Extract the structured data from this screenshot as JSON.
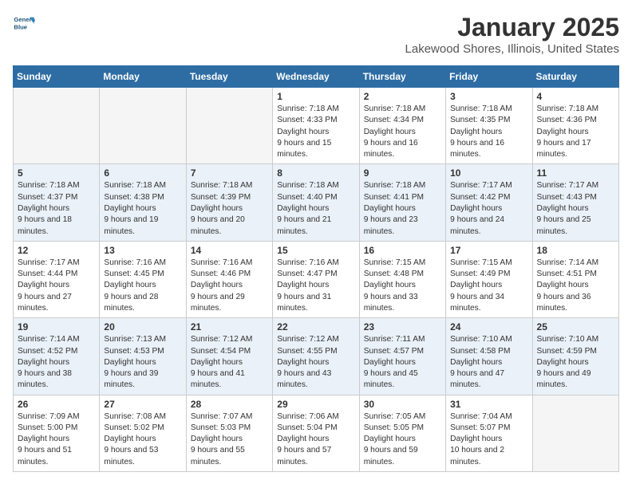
{
  "header": {
    "logo_line1": "General",
    "logo_line2": "Blue",
    "month": "January 2025",
    "location": "Lakewood Shores, Illinois, United States"
  },
  "days_of_week": [
    "Sunday",
    "Monday",
    "Tuesday",
    "Wednesday",
    "Thursday",
    "Friday",
    "Saturday"
  ],
  "weeks": [
    {
      "alt": false,
      "days": [
        {
          "num": "",
          "empty": true
        },
        {
          "num": "",
          "empty": true
        },
        {
          "num": "",
          "empty": true
        },
        {
          "num": "1",
          "sunrise": "7:18 AM",
          "sunset": "4:33 PM",
          "daylight": "9 hours and 15 minutes."
        },
        {
          "num": "2",
          "sunrise": "7:18 AM",
          "sunset": "4:34 PM",
          "daylight": "9 hours and 16 minutes."
        },
        {
          "num": "3",
          "sunrise": "7:18 AM",
          "sunset": "4:35 PM",
          "daylight": "9 hours and 16 minutes."
        },
        {
          "num": "4",
          "sunrise": "7:18 AM",
          "sunset": "4:36 PM",
          "daylight": "9 hours and 17 minutes."
        }
      ]
    },
    {
      "alt": true,
      "days": [
        {
          "num": "5",
          "sunrise": "7:18 AM",
          "sunset": "4:37 PM",
          "daylight": "9 hours and 18 minutes."
        },
        {
          "num": "6",
          "sunrise": "7:18 AM",
          "sunset": "4:38 PM",
          "daylight": "9 hours and 19 minutes."
        },
        {
          "num": "7",
          "sunrise": "7:18 AM",
          "sunset": "4:39 PM",
          "daylight": "9 hours and 20 minutes."
        },
        {
          "num": "8",
          "sunrise": "7:18 AM",
          "sunset": "4:40 PM",
          "daylight": "9 hours and 21 minutes."
        },
        {
          "num": "9",
          "sunrise": "7:18 AM",
          "sunset": "4:41 PM",
          "daylight": "9 hours and 23 minutes."
        },
        {
          "num": "10",
          "sunrise": "7:17 AM",
          "sunset": "4:42 PM",
          "daylight": "9 hours and 24 minutes."
        },
        {
          "num": "11",
          "sunrise": "7:17 AM",
          "sunset": "4:43 PM",
          "daylight": "9 hours and 25 minutes."
        }
      ]
    },
    {
      "alt": false,
      "days": [
        {
          "num": "12",
          "sunrise": "7:17 AM",
          "sunset": "4:44 PM",
          "daylight": "9 hours and 27 minutes."
        },
        {
          "num": "13",
          "sunrise": "7:16 AM",
          "sunset": "4:45 PM",
          "daylight": "9 hours and 28 minutes."
        },
        {
          "num": "14",
          "sunrise": "7:16 AM",
          "sunset": "4:46 PM",
          "daylight": "9 hours and 29 minutes."
        },
        {
          "num": "15",
          "sunrise": "7:16 AM",
          "sunset": "4:47 PM",
          "daylight": "9 hours and 31 minutes."
        },
        {
          "num": "16",
          "sunrise": "7:15 AM",
          "sunset": "4:48 PM",
          "daylight": "9 hours and 33 minutes."
        },
        {
          "num": "17",
          "sunrise": "7:15 AM",
          "sunset": "4:49 PM",
          "daylight": "9 hours and 34 minutes."
        },
        {
          "num": "18",
          "sunrise": "7:14 AM",
          "sunset": "4:51 PM",
          "daylight": "9 hours and 36 minutes."
        }
      ]
    },
    {
      "alt": true,
      "days": [
        {
          "num": "19",
          "sunrise": "7:14 AM",
          "sunset": "4:52 PM",
          "daylight": "9 hours and 38 minutes."
        },
        {
          "num": "20",
          "sunrise": "7:13 AM",
          "sunset": "4:53 PM",
          "daylight": "9 hours and 39 minutes."
        },
        {
          "num": "21",
          "sunrise": "7:12 AM",
          "sunset": "4:54 PM",
          "daylight": "9 hours and 41 minutes."
        },
        {
          "num": "22",
          "sunrise": "7:12 AM",
          "sunset": "4:55 PM",
          "daylight": "9 hours and 43 minutes."
        },
        {
          "num": "23",
          "sunrise": "7:11 AM",
          "sunset": "4:57 PM",
          "daylight": "9 hours and 45 minutes."
        },
        {
          "num": "24",
          "sunrise": "7:10 AM",
          "sunset": "4:58 PM",
          "daylight": "9 hours and 47 minutes."
        },
        {
          "num": "25",
          "sunrise": "7:10 AM",
          "sunset": "4:59 PM",
          "daylight": "9 hours and 49 minutes."
        }
      ]
    },
    {
      "alt": false,
      "days": [
        {
          "num": "26",
          "sunrise": "7:09 AM",
          "sunset": "5:00 PM",
          "daylight": "9 hours and 51 minutes."
        },
        {
          "num": "27",
          "sunrise": "7:08 AM",
          "sunset": "5:02 PM",
          "daylight": "9 hours and 53 minutes."
        },
        {
          "num": "28",
          "sunrise": "7:07 AM",
          "sunset": "5:03 PM",
          "daylight": "9 hours and 55 minutes."
        },
        {
          "num": "29",
          "sunrise": "7:06 AM",
          "sunset": "5:04 PM",
          "daylight": "9 hours and 57 minutes."
        },
        {
          "num": "30",
          "sunrise": "7:05 AM",
          "sunset": "5:05 PM",
          "daylight": "9 hours and 59 minutes."
        },
        {
          "num": "31",
          "sunrise": "7:04 AM",
          "sunset": "5:07 PM",
          "daylight": "10 hours and 2 minutes."
        },
        {
          "num": "",
          "empty": true
        }
      ]
    }
  ]
}
